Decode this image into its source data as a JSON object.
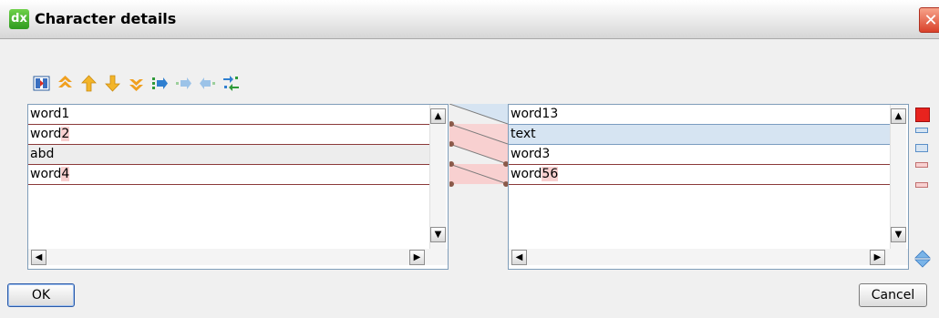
{
  "window": {
    "title": "Character details",
    "app_icon_text": "dx",
    "close_symbol": "✕"
  },
  "toolbar": {
    "icons": [
      "compare-icon",
      "first-diff-icon",
      "prev-diff-icon",
      "next-diff-icon",
      "last-diff-icon",
      "copy-right-icon",
      "copy-right-next-icon",
      "copy-left-icon",
      "merge-all-icon"
    ]
  },
  "left_list": {
    "rows": [
      {
        "text": "word1",
        "highlight": ""
      },
      {
        "text": "word",
        "highlight": "2"
      },
      {
        "text": "abd",
        "highlight": ""
      },
      {
        "text": "word",
        "highlight": "4"
      }
    ]
  },
  "right_list": {
    "rows": [
      {
        "text": "word13",
        "highlight": ""
      },
      {
        "text": "text",
        "highlight": ""
      },
      {
        "text": "word3",
        "highlight": ""
      },
      {
        "text": "word",
        "highlight": "56"
      }
    ]
  },
  "scroll": {
    "up": "▲",
    "down": "▼",
    "left": "◀",
    "right": "▶"
  },
  "buttons": {
    "ok": "OK",
    "cancel": "Cancel"
  },
  "colors": {
    "removed": "#f8d0d0",
    "changed": "#d6e4f2",
    "current": "#e8231e"
  }
}
